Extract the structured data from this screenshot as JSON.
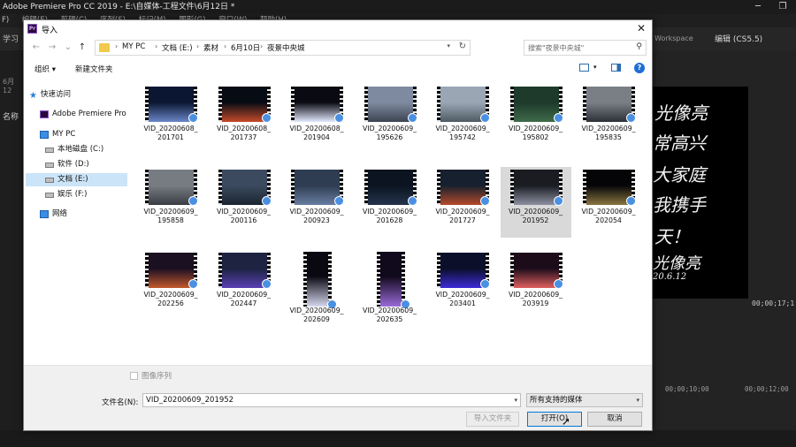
{
  "app": {
    "title": "Adobe Premiere Pro CC 2019 - E:\\自媒体-工程文件\\6月12日 *",
    "menu": [
      "F)",
      "编辑(E)",
      "剪辑(C)",
      "序列(S)",
      "标记(M)",
      "图形(G)",
      "窗口(W)",
      "帮助(H)"
    ],
    "workspace_left": "学习",
    "workspace_tab": "Workspace",
    "workspace_edit": "编辑 (CS5.5)",
    "left_panel": {
      "label1": "6月12",
      "label2": "名称"
    },
    "timecode": "00;00;17;1",
    "ruler": [
      "00;00;10;00",
      "00;00;12;00"
    ],
    "handwriting": [
      "光像亮",
      "常高兴",
      "大家庭",
      "我携手",
      "天！",
      "光像亮",
      "20.6.12"
    ]
  },
  "dialog": {
    "title": "导入",
    "close": "✕",
    "nav": {
      "back": "←",
      "forward": "→",
      "recent": "⌄",
      "up": "↑"
    },
    "breadcrumb": [
      "MY PC",
      "文档 (E:)",
      "素材",
      "6月10日",
      "夜景中央城"
    ],
    "search_placeholder": "搜索\"夜景中央城\"",
    "toolbar": {
      "organize": "组织 ▾",
      "new_folder": "新建文件夹",
      "help": "?"
    },
    "sidebar": [
      {
        "label": "快速访问",
        "icon": "star-icon"
      },
      {
        "label": "Adobe Premiere Pro",
        "icon": "premiere-icon"
      },
      {
        "label": "MY PC",
        "icon": "computer-icon"
      },
      {
        "label": "本地磁盘 (C:)",
        "icon": "drive-icon"
      },
      {
        "label": "软件 (D:)",
        "icon": "drive-icon"
      },
      {
        "label": "文档 (E:)",
        "icon": "drive-icon",
        "selected": true
      },
      {
        "label": "娱乐 (F:)",
        "icon": "drive-icon"
      },
      {
        "label": "网络",
        "icon": "network-icon"
      }
    ],
    "files": [
      {
        "line1": "VID_20200608_",
        "line2": "201701"
      },
      {
        "line1": "VID_20200608_",
        "line2": "201737"
      },
      {
        "line1": "VID_20200608_",
        "line2": "201904"
      },
      {
        "line1": "VID_20200609_",
        "line2": "195626"
      },
      {
        "line1": "VID_20200609_",
        "line2": "195742"
      },
      {
        "line1": "VID_20200609_",
        "line2": "195802"
      },
      {
        "line1": "VID_20200609_",
        "line2": "195835"
      },
      {
        "line1": "VID_20200609_",
        "line2": "195858"
      },
      {
        "line1": "VID_20200609_",
        "line2": "200116"
      },
      {
        "line1": "VID_20200609_",
        "line2": "200923"
      },
      {
        "line1": "VID_20200609_",
        "line2": "201628"
      },
      {
        "line1": "VID_20200609_",
        "line2": "201727"
      },
      {
        "line1": "VID_20200609_",
        "line2": "201952",
        "selected": true
      },
      {
        "line1": "VID_20200609_",
        "line2": "202054"
      },
      {
        "line1": "VID_20200609_",
        "line2": "202256"
      },
      {
        "line1": "VID_20200609_",
        "line2": "202447"
      },
      {
        "line1": "VID_20200609_",
        "line2": "202609",
        "portrait": true
      },
      {
        "line1": "VID_20200609_",
        "line2": "202635",
        "portrait": true
      },
      {
        "line1": "VID_20200609_",
        "line2": "203401"
      },
      {
        "line1": "VID_20200609_",
        "line2": "203919"
      }
    ],
    "image_sequence_label": "图像序列",
    "filename_label": "文件名(N):",
    "filename_value": "VID_20200609_201952",
    "filetype_value": "所有支持的媒体",
    "buttons": {
      "import_folder": "导入文件夹",
      "open": "打开(O)",
      "cancel": "取消"
    }
  }
}
